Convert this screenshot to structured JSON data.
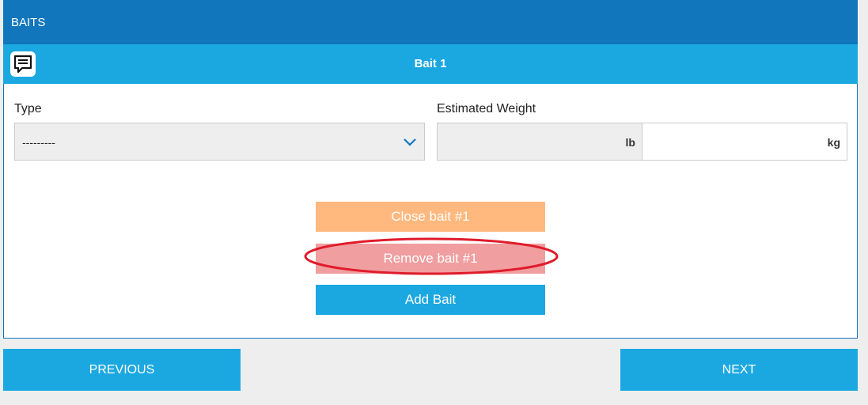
{
  "header": {
    "title": "BAITS"
  },
  "bait": {
    "title": "Bait 1",
    "comment_icon": "comment-icon"
  },
  "fields": {
    "type_label": "Type",
    "type_value": "---------",
    "weight_label": "Estimated Weight",
    "lb_unit": "lb",
    "kg_unit": "kg",
    "lb_value": "",
    "kg_value": ""
  },
  "actions": {
    "close_label": "Close bait #1",
    "remove_label": "Remove bait #1",
    "add_label": "Add Bait"
  },
  "nav": {
    "previous_label": "PREVIOUS",
    "next_label": "NEXT"
  },
  "colors": {
    "header": "#1176bb",
    "subheader": "#1ba8e0",
    "close_button": "#ffb87e",
    "remove_button": "#f09ea0",
    "add_button": "#1ba8e0",
    "highlight_ring": "#e01b2b"
  }
}
